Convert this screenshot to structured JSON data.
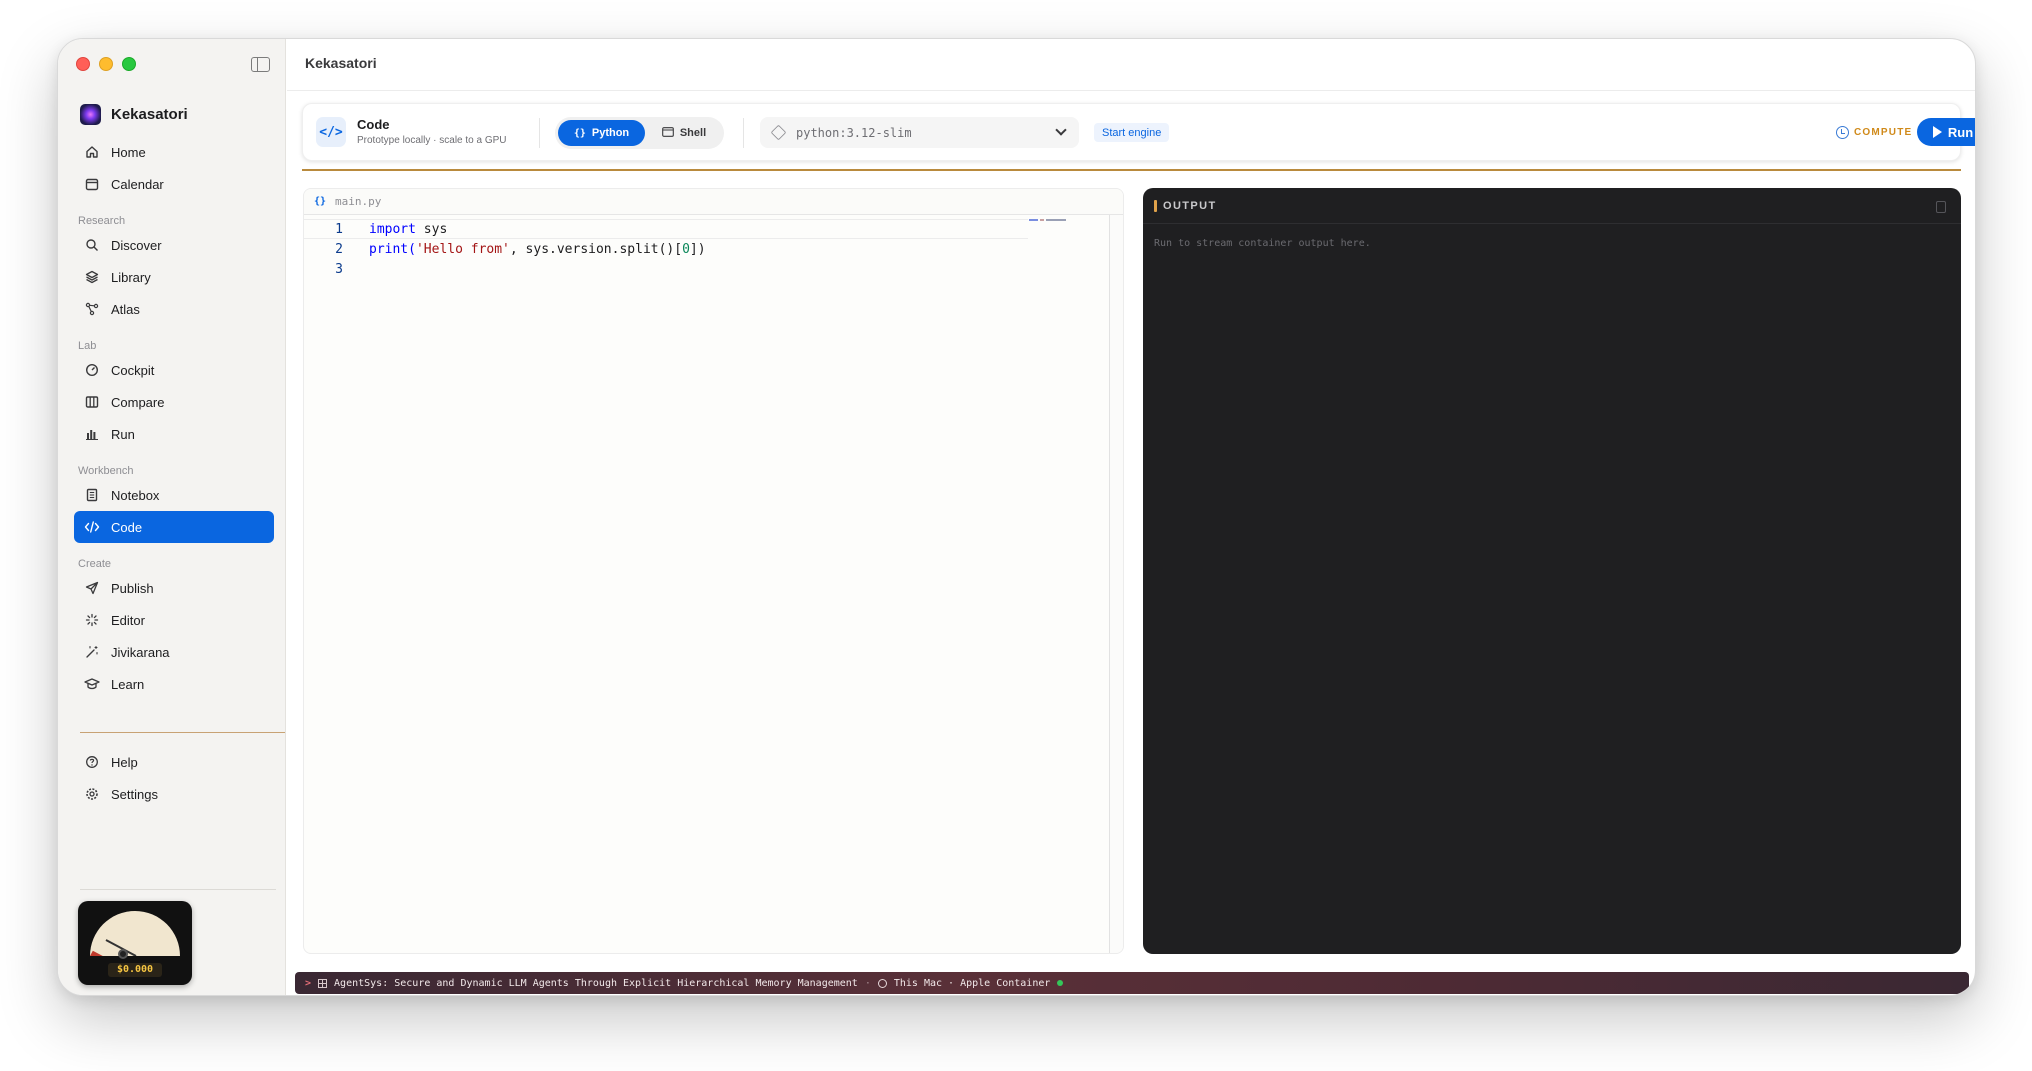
{
  "app": {
    "title": "Kekasatori",
    "brand": "Kekasatori"
  },
  "sidebar": {
    "top_items": [
      {
        "label": "Home",
        "icon": "home-icon"
      },
      {
        "label": "Calendar",
        "icon": "calendar-icon"
      }
    ],
    "sections": [
      {
        "title": "Research",
        "items": [
          {
            "label": "Discover",
            "icon": "search-icon"
          },
          {
            "label": "Library",
            "icon": "layers-icon"
          },
          {
            "label": "Atlas",
            "icon": "graph-icon"
          }
        ]
      },
      {
        "title": "Lab",
        "items": [
          {
            "label": "Cockpit",
            "icon": "gauge-icon"
          },
          {
            "label": "Compare",
            "icon": "columns-icon"
          },
          {
            "label": "Run",
            "icon": "bar-chart-icon"
          }
        ]
      },
      {
        "title": "Workbench",
        "items": [
          {
            "label": "Notebox",
            "icon": "notebook-icon"
          },
          {
            "label": "Code",
            "icon": "code-icon",
            "active": true
          }
        ]
      },
      {
        "title": "Create",
        "items": [
          {
            "label": "Publish",
            "icon": "send-icon"
          },
          {
            "label": "Editor",
            "icon": "sparkle-icon"
          },
          {
            "label": "Jivikarana",
            "icon": "wand-icon"
          },
          {
            "label": "Learn",
            "icon": "graduation-cap-icon"
          }
        ]
      }
    ],
    "bottom_items": [
      {
        "label": "Help",
        "icon": "help-icon"
      },
      {
        "label": "Settings",
        "icon": "gear-icon"
      }
    ],
    "cost_meter": "$0.000"
  },
  "toolbar": {
    "title": "Code",
    "subtitle": "Prototype locally · scale to a GPU",
    "mode_python": "Python",
    "mode_shell": "Shell",
    "image_value": "python:3.12-slim",
    "start_engine": "Start engine",
    "compute_label": "COMPUTE",
    "run_label": "Run"
  },
  "editor": {
    "filename": "main.py",
    "line_numbers": [
      "1",
      "2",
      "3"
    ],
    "line1": {
      "kw": "import",
      "rest": " sys"
    },
    "line2": {
      "fn": "print(",
      "str": "'Hello from'",
      "mid": ", sys.version.split()[",
      "num": "0",
      "end": "])"
    }
  },
  "output": {
    "title": "OUTPUT",
    "placeholder": "Run to stream container output here."
  },
  "statusbar": {
    "project": "AgentSys: Secure and Dynamic LLM Agents Through Explicit Hierarchical Memory Management",
    "separator": "·",
    "runtime": "This Mac · Apple Container"
  },
  "colors": {
    "accent": "#0a66e0",
    "compute": "#d08a1a",
    "output_bg": "#1f1f21",
    "status_ok": "#34c759"
  }
}
